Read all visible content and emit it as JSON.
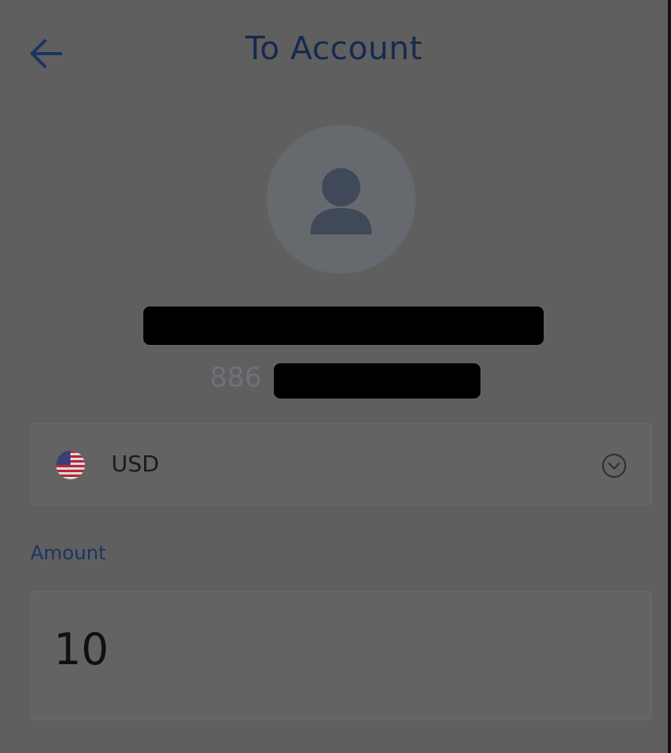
{
  "header": {
    "title": "To Account",
    "back_icon": "arrow-left-icon"
  },
  "recipient": {
    "avatar_icon": "user-icon",
    "name": "",
    "account_number_visible": "886"
  },
  "currency": {
    "code": "USD",
    "flag_icon": "us-flag-icon",
    "dropdown_icon": "chevron-down-circle-icon"
  },
  "amount": {
    "label": "Amount",
    "value": "10"
  },
  "remark": {
    "hint": ""
  },
  "colors": {
    "title": "#162a4f",
    "accent": "#1b3560",
    "overlay_background": "#5f5f60"
  }
}
